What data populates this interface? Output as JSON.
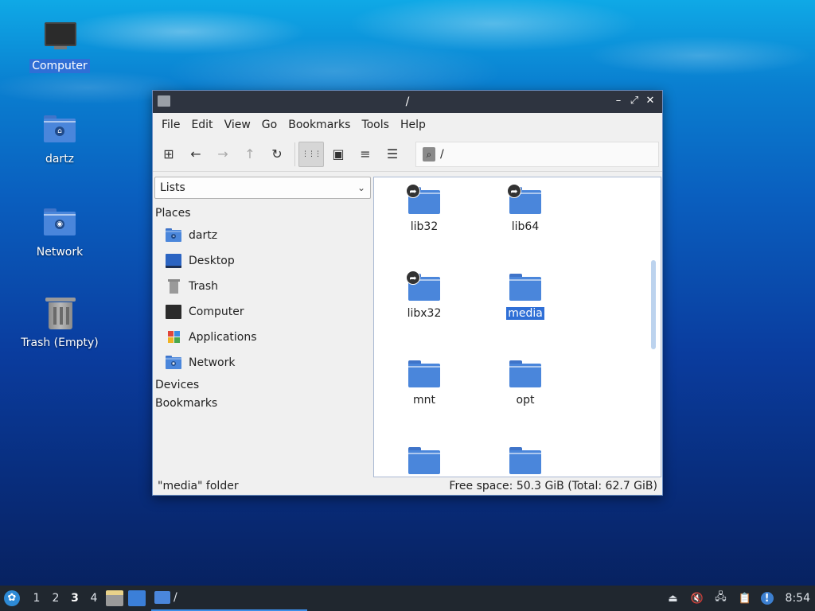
{
  "desktop": {
    "icons": [
      {
        "label": "Computer",
        "icon": "monitor-icon"
      },
      {
        "label": "dartz",
        "icon": "home-folder-icon"
      },
      {
        "label": "Network",
        "icon": "network-folder-icon"
      },
      {
        "label": "Trash (Empty)",
        "icon": "trash-icon"
      }
    ]
  },
  "window": {
    "title": "/",
    "controls": {
      "minimize": "–",
      "maximize": "⤢",
      "close": "✕"
    },
    "menu": [
      "File",
      "Edit",
      "View",
      "Go",
      "Bookmarks",
      "Tools",
      "Help"
    ],
    "toolbar": {
      "icons": [
        "new-tab-icon",
        "back-icon",
        "forward-icon",
        "up-icon",
        "reload-icon",
        "icon-view-icon",
        "thumbnail-view-icon",
        "compact-view-icon",
        "detailed-list-icon"
      ],
      "glyphs": {
        "new_tab": "⊞",
        "back": "←",
        "forward": "→",
        "up": "↑",
        "reload": "↻",
        "icon_view": "⋮⋮⋮",
        "thumb_view": "▣",
        "compact": "≡",
        "detailed": "☰"
      },
      "path": "/",
      "path_icon": "⌕"
    },
    "side": {
      "selector": "Lists",
      "chevron": "⌄",
      "sections": [
        "Places",
        "Devices",
        "Bookmarks"
      ],
      "places": [
        {
          "label": "dartz",
          "icon": "home-folder-icon"
        },
        {
          "label": "Desktop",
          "icon": "desktop-icon"
        },
        {
          "label": "Trash",
          "icon": "trash-icon"
        },
        {
          "label": "Computer",
          "icon": "computer-icon"
        },
        {
          "label": "Applications",
          "icon": "applications-icon"
        },
        {
          "label": "Network",
          "icon": "network-folder-icon"
        }
      ]
    },
    "files": [
      {
        "name": "lib32",
        "link": true
      },
      {
        "name": "lib64",
        "link": true
      },
      {
        "name": "libx32",
        "link": true
      },
      {
        "name": "media",
        "link": false,
        "selected": true
      },
      {
        "name": "mnt",
        "link": false
      },
      {
        "name": "opt",
        "link": false
      },
      {
        "name": "",
        "link": false
      },
      {
        "name": "",
        "link": false
      }
    ],
    "link_glyph": "➦",
    "status": {
      "left": "\"media\" folder",
      "right": "Free space: 50.3 GiB (Total: 62.7 GiB)"
    }
  },
  "taskbar": {
    "start_glyph": "✿",
    "workspaces": [
      "1",
      "2",
      "3",
      "4"
    ],
    "active_workspace": "3",
    "task_title": "/",
    "tray_glyphs": {
      "eject": "⏏",
      "mute": "🔇",
      "network": "🖧",
      "clipboard": "📋",
      "update": "!"
    },
    "clock": "8:54"
  },
  "colors": {
    "accent": "#2f6fd6",
    "folder": "#4a86db",
    "titlebar": "#2e3440",
    "taskbar": "#20272f"
  }
}
